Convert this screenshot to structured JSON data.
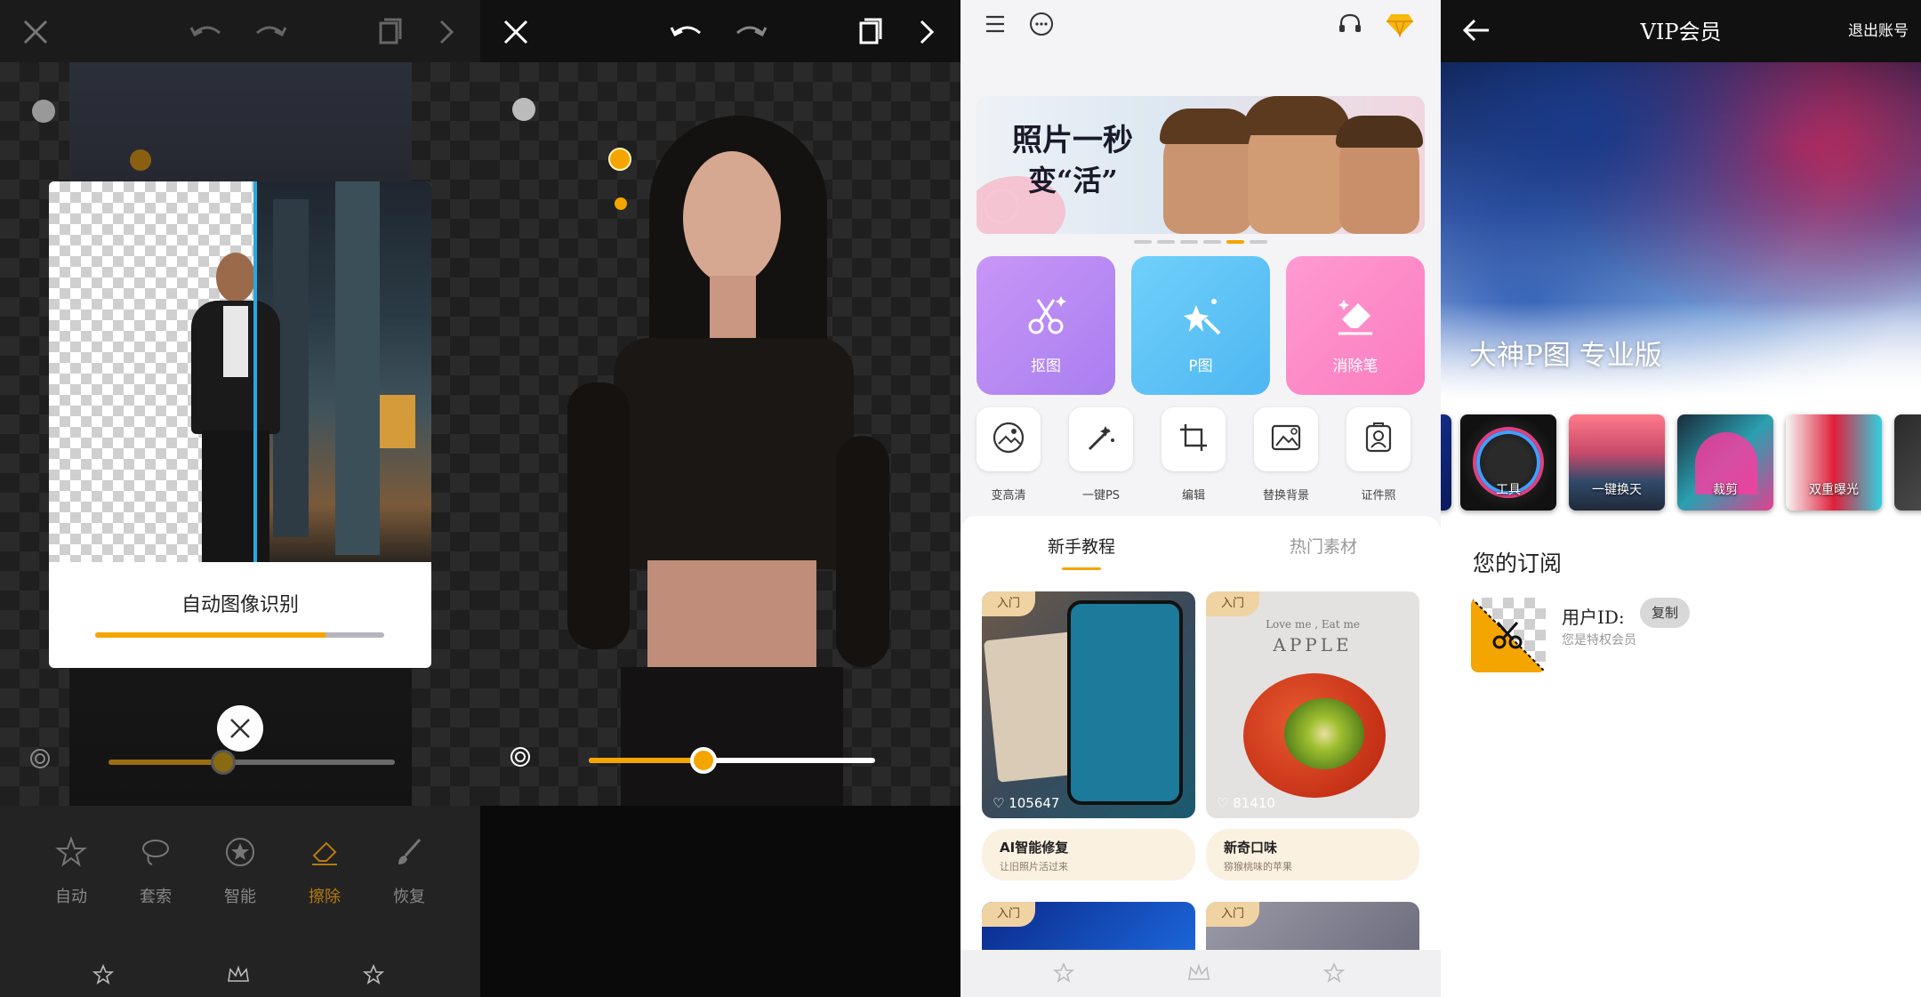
{
  "panel1": {
    "dialog_title": "自动图像识别",
    "progress": 0.8,
    "tools": [
      {
        "label": "自动",
        "icon": "star-a-icon",
        "active": false
      },
      {
        "label": "套索",
        "icon": "lasso-icon",
        "active": false
      },
      {
        "label": "智能",
        "icon": "smart-star-icon",
        "active": false
      },
      {
        "label": "擦除",
        "icon": "eraser-icon",
        "active": true
      },
      {
        "label": "恢复",
        "icon": "brush-icon",
        "active": false
      }
    ],
    "slider_value": 0.4
  },
  "panel2": {
    "slider_value": 0.4
  },
  "panel3": {
    "banner": {
      "line1": "照片一秒",
      "line2": "变“活”"
    },
    "features": [
      {
        "label": "抠图",
        "icon": "cutout-scissors-icon",
        "color": "#b784f0"
      },
      {
        "label": "P图",
        "icon": "magic-wand-icon",
        "color": "#5cc6f5"
      },
      {
        "label": "消除笔",
        "icon": "eraser-icon",
        "color": "#ff8ec9"
      }
    ],
    "tools": [
      {
        "label": "变高清",
        "icon": "hd-icon"
      },
      {
        "label": "一键PS",
        "icon": "wand-icon"
      },
      {
        "label": "编辑",
        "icon": "crop-icon"
      },
      {
        "label": "替换背景",
        "icon": "image-replace-icon"
      },
      {
        "label": "证件照",
        "icon": "id-photo-icon"
      }
    ],
    "tabs": [
      "新手教程",
      "热门素材"
    ],
    "cards": [
      {
        "badge": "入门",
        "likes": "105647",
        "title": "AI智能修复",
        "subtitle": "让旧照片活过来"
      },
      {
        "badge": "入门",
        "likes": "81410",
        "title": "新奇口味",
        "subtitle": "猕猴桃味的苹果",
        "overlay_small": "Love me , Eat me",
        "overlay_big": "APPLE"
      }
    ],
    "lower_badges": [
      "入门",
      "入门"
    ]
  },
  "panel4": {
    "title": "VIP会员",
    "logout": "退出账号",
    "hero_text": "大神P图 专业版",
    "thumbs": [
      "工具",
      "一键换天",
      "裁剪",
      "双重曝光"
    ],
    "subscription_heading": "您的订阅",
    "user_id_label": "用户ID:",
    "copy_button": "复制",
    "member_status": "您是特权会员"
  }
}
